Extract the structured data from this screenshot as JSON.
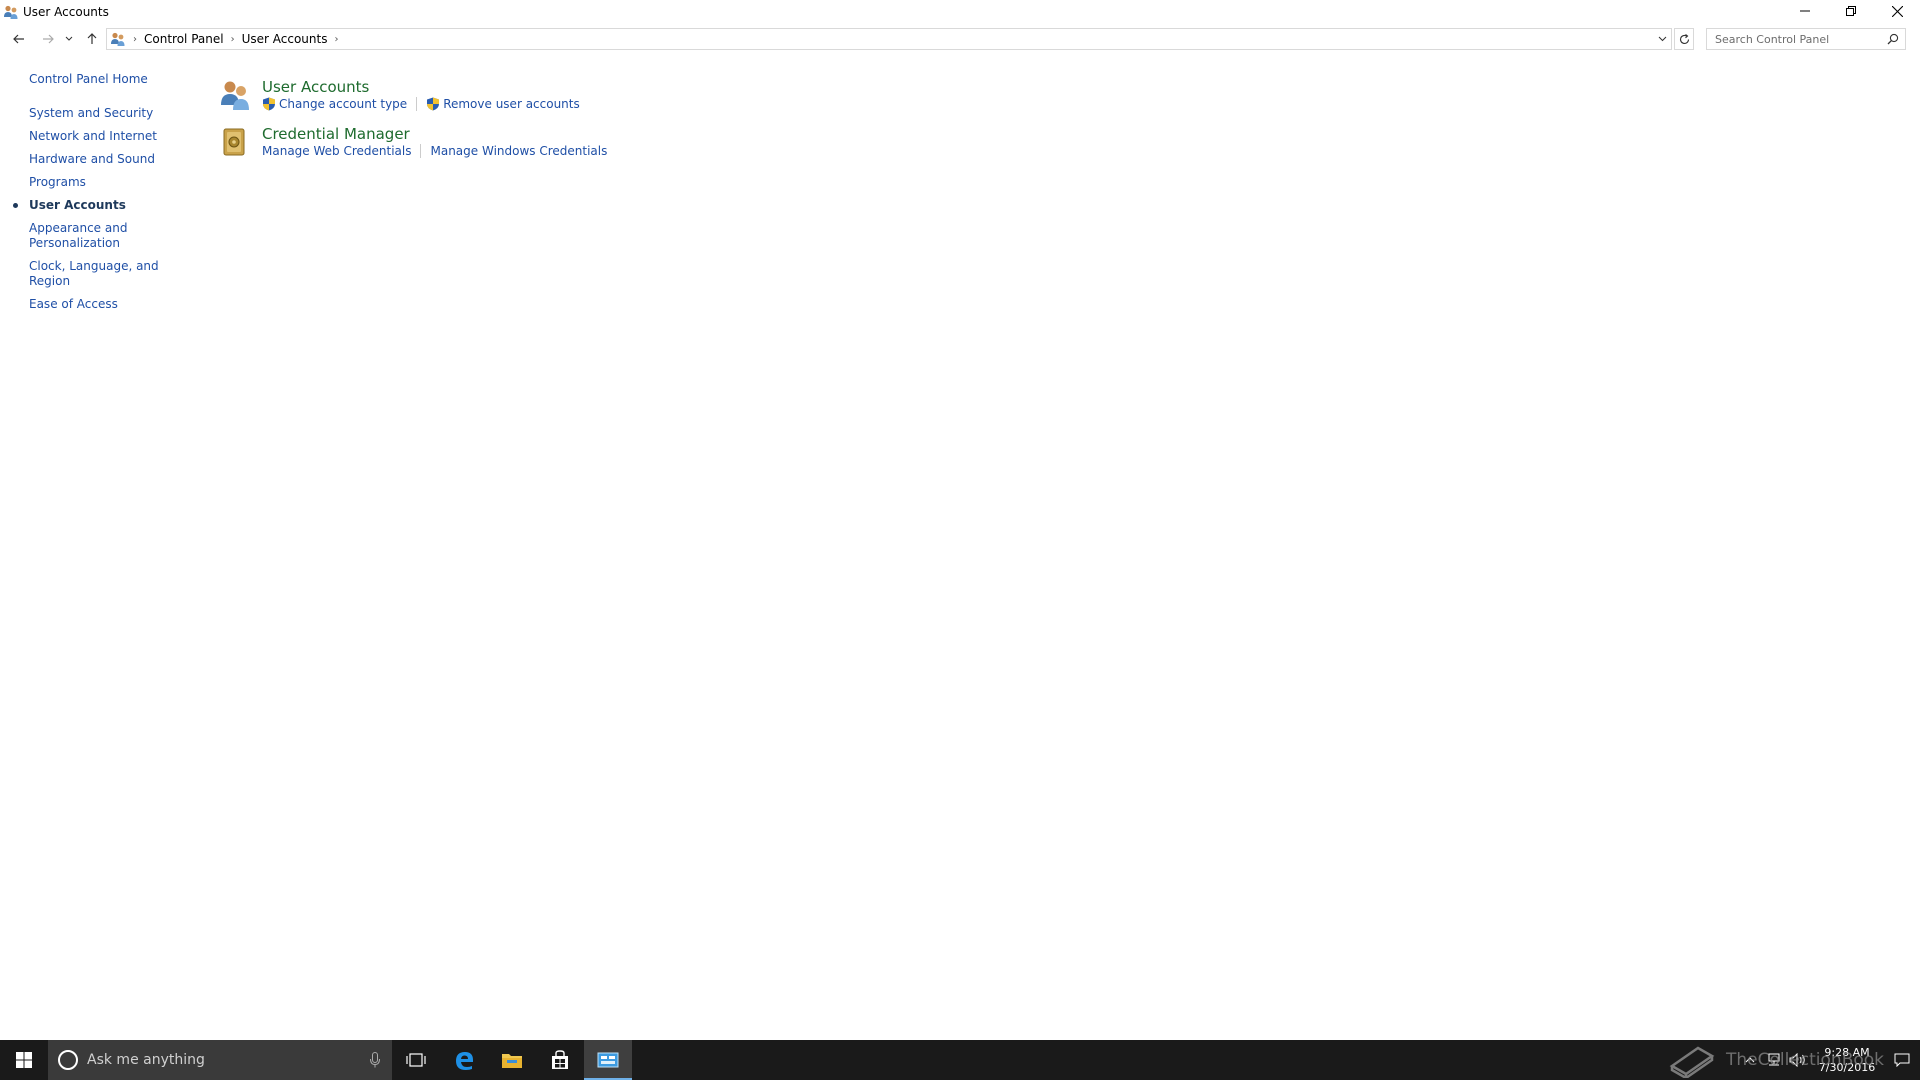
{
  "window": {
    "title": "User Accounts"
  },
  "address": {
    "crumbs": [
      "Control Panel",
      "User Accounts"
    ],
    "search_placeholder": "Search Control Panel"
  },
  "leftnav": {
    "home": "Control Panel Home",
    "items": [
      {
        "label": "System and Security"
      },
      {
        "label": "Network and Internet"
      },
      {
        "label": "Hardware and Sound"
      },
      {
        "label": "Programs"
      },
      {
        "label": "User Accounts",
        "current": true
      },
      {
        "label": "Appearance and Personalization"
      },
      {
        "label": "Clock, Language, and Region"
      },
      {
        "label": "Ease of Access"
      }
    ]
  },
  "categories": [
    {
      "title": "User Accounts",
      "icon": "users-icon",
      "links": [
        "Change account type",
        "Remove user accounts"
      ]
    },
    {
      "title": "Credential Manager",
      "icon": "vault-icon",
      "links": [
        "Manage Web Credentials",
        "Manage Windows Credentials"
      ]
    }
  ],
  "taskbar": {
    "search_placeholder": "Ask me anything",
    "time": "9:28 AM",
    "date": "7/30/2016"
  },
  "watermark": "TheCollectionBook",
  "colors": {
    "link": "#1f4fa6",
    "category_title": "#1e6b2e",
    "taskbar": "#1a1a1a",
    "accent": "#6fb1e9"
  }
}
